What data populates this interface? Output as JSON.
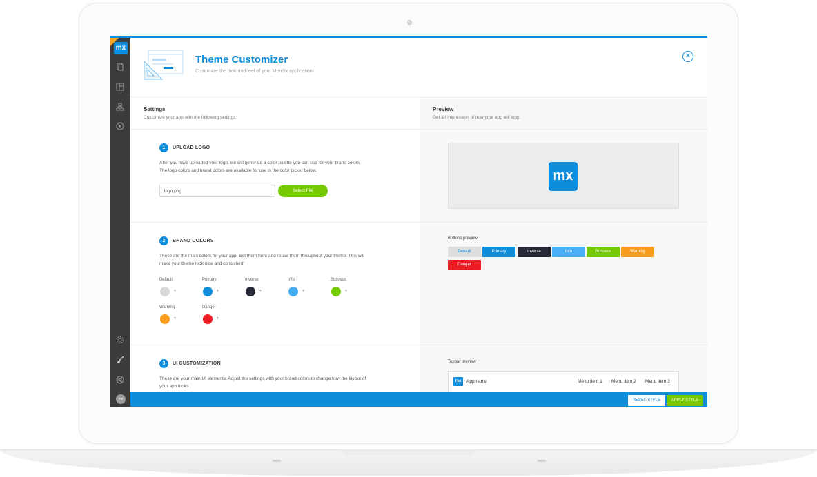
{
  "header": {
    "title": "Theme Customizer",
    "subtitle": "Customize the look and feel of your Mendix application"
  },
  "sidebar": {
    "logo": "mx",
    "avatar": "mx",
    "items": [
      {
        "icon": "pages-icon"
      },
      {
        "icon": "app-explorer-icon"
      },
      {
        "icon": "sitemap-icon"
      },
      {
        "icon": "play-icon"
      },
      {
        "icon": "gear-icon"
      },
      {
        "icon": "brush-icon"
      },
      {
        "icon": "announcement-icon"
      }
    ]
  },
  "settings": {
    "title": "Settings",
    "subtitle": "Customize your app with the following settings:"
  },
  "preview": {
    "title": "Preview",
    "subtitle": "Get an impression of how your app will look:",
    "logo_text": "mx",
    "buttons_label": "Buttons preview",
    "topbar_label": "Topbar preview",
    "topbar": {
      "logo": "mx",
      "app_name": "App name",
      "menu": [
        "Menu item 1",
        "Menu item 2",
        "Menu item 3"
      ]
    }
  },
  "steps": [
    {
      "num": "1",
      "title": "UPLOAD LOGO",
      "desc": "After you have uploaded your logo, we will generate a color palette you can use for your brand colors. The logo colors and brand colors are available for use in the color picker below.",
      "file_value": "logo.png",
      "button": "Select File"
    },
    {
      "num": "2",
      "title": "BRAND COLORS",
      "desc": "These are the main colors for your app. Set them here and reuse them throughout your theme. This will make your theme look nice and consistent!"
    },
    {
      "num": "3",
      "title": "UI CUSTOMIZATION",
      "desc": "These are your main UI elements. Adjust the settings with your brand colors to change how the layout of your app looks."
    }
  ],
  "brand_colors": [
    {
      "name": "Default",
      "color": "#d9d9d9"
    },
    {
      "name": "Primary",
      "color": "#0d8ddc"
    },
    {
      "name": "Inverse",
      "color": "#262a36"
    },
    {
      "name": "Info",
      "color": "#48b0f7"
    },
    {
      "name": "Success",
      "color": "#76ca02"
    },
    {
      "name": "Warning",
      "color": "#f99b1d"
    },
    {
      "name": "Danger",
      "color": "#ed1c24"
    }
  ],
  "preview_buttons": [
    {
      "label": "Default",
      "bg": "#dddddd",
      "fg": "#0d8ddc"
    },
    {
      "label": "Primary",
      "bg": "#0d8ddc",
      "fg": "#ffffff"
    },
    {
      "label": "Inverse",
      "bg": "#262a36",
      "fg": "#ffffff"
    },
    {
      "label": "Info",
      "bg": "#48b0f7",
      "fg": "#ffffff"
    },
    {
      "label": "Success",
      "bg": "#76ca02",
      "fg": "#ffffff"
    },
    {
      "label": "Warning",
      "bg": "#f99b1d",
      "fg": "#ffffff"
    },
    {
      "label": "Danger",
      "bg": "#ed1c24",
      "fg": "#ffffff"
    }
  ],
  "footer": {
    "reset": "RESET STYLE",
    "apply": "APPLY STYLE"
  }
}
